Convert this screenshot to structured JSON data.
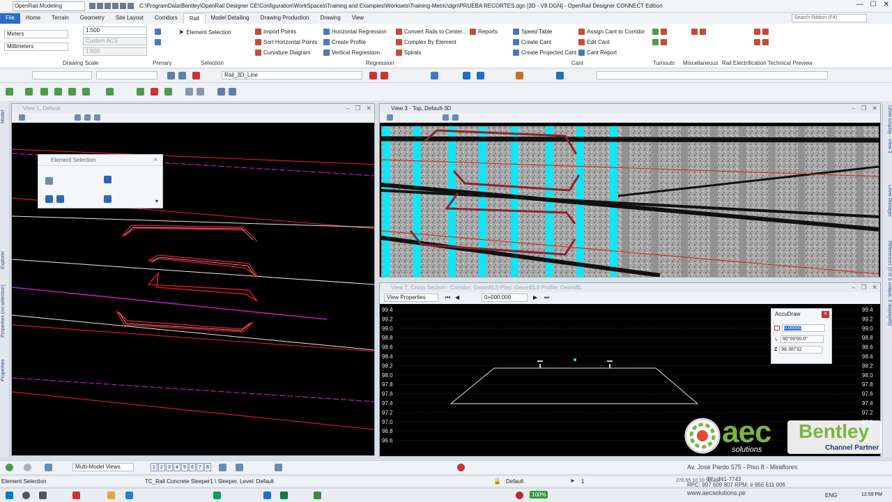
{
  "titlebar": {
    "workflow": "OpenRail Modeling",
    "path": "C:\\ProgramData\\Bentley\\OpenRail Designer CE\\Configuration\\WorkSpaces\\Training and Examples\\Worksets\\Training-Metric\\dgn\\PRUEBA RECORTES.dgn [3D - V8 DGN] - OpenRail Designer CONNECT Edition"
  },
  "tabs": [
    "File",
    "Home",
    "Terrain",
    "Geometry",
    "Site Layout",
    "Corridors",
    "Rail",
    "Model Detailing",
    "Drawing Production",
    "Drawing",
    "View"
  ],
  "active_tab": "Rail",
  "search_placeholder": "Search Ribbon (F4)",
  "ribbon": {
    "drawing_scale": {
      "units1": "Meters",
      "units2": "Millimeters",
      "scale": "1:500",
      "acs": "Custom ACS",
      "scale2": "1:500",
      "label": "Drawing Scale"
    },
    "primary_label": "Primary",
    "selection": {
      "element_selection": "Element Selection",
      "label": "Selection"
    },
    "regression": {
      "import_points": "Import Points",
      "sort_horizontal_points": "Sort Horizontal Points",
      "curvature_diagram": "Curvature Diagram",
      "horizontal_regression": "Horizontal Regression",
      "create_profile": "Create Profile",
      "vertical_regression": "Vertical Regression",
      "convert_rails": "Convert Rails to Center...",
      "complex_by_element": "Complex By Element",
      "spirals": "Spirals",
      "reports": "Reports",
      "label": "Regression"
    },
    "cant": {
      "speed_table": "Speed Table",
      "create_cant": "Create Cant",
      "create_projected_cant": "Create Projected Cant",
      "assign_cant": "Assign Cant to Corridor",
      "edit_cant": "Edit Cant",
      "cant_report": "Cant Report",
      "label": "Cant"
    },
    "turnouts_label": "Turnouts",
    "misc_label": "Miscellaneous",
    "electrification_label": "Rail Electrification Technical Preview"
  },
  "attrbar": {
    "line_style": "Rail_3D_Line"
  },
  "left_tabs": [
    "Model",
    "Explorer",
    "Properties (no selection)",
    "Properties"
  ],
  "right_tabs": [
    "Level Display - View 3",
    "Level Manager",
    "References (0 of 0 unique, 0 displayed)"
  ],
  "view1": {
    "title": "View 1, Default"
  },
  "element_selection_dialog": {
    "title": "Element Selection"
  },
  "view3": {
    "title": "View 3 - Top, Default-3D"
  },
  "view7": {
    "title": "View 7, Cross Section - Corridor: GeomBL5 Plan: GeomBL5 Profile: GeomBL",
    "view_properties": "View Properties",
    "station": "0+000.000",
    "y_ticks": [
      "99.4",
      "99.2",
      "99.0",
      "98.8",
      "98.6",
      "98.4",
      "98.2",
      "98.0",
      "97.8",
      "97.6",
      "97.4",
      "97.2",
      "97.0",
      "96.8",
      "96.6"
    ]
  },
  "accudraw": {
    "title": "AccuDraw",
    "distance": "0.00000",
    "angle": "90°00'00.0\"",
    "z_label": "Z",
    "z": "98.38732"
  },
  "viewbar": {
    "views_label": "Multi-Model Views",
    "view_numbers": [
      "1",
      "2",
      "3",
      "4",
      "5",
      "6",
      "7",
      "8"
    ]
  },
  "status": {
    "left": "Element Selection",
    "middle": "TC_Rail Concrete Sleeper1 \\ Sleeper, Level: Default",
    "level": "Default",
    "snap": "1"
  },
  "watermark": {
    "address": "Av. José Pardo 575 - Piso 8 - Miraflores",
    "tel": "Tlf.: 241-7743",
    "rpc": "RPC: 997 609 807 RPM: # 956 611 006",
    "web": "www.aecsolutions.pe",
    "coords": "270.55 10.10 98.387"
  },
  "logo": {
    "aec": "aec",
    "solutions": "solutions",
    "bentley": "Bentley",
    "channel": "Channel Partner"
  },
  "taskbar": {
    "zoom": "100%",
    "lang": "ENG",
    "time": "12:59 PM"
  }
}
